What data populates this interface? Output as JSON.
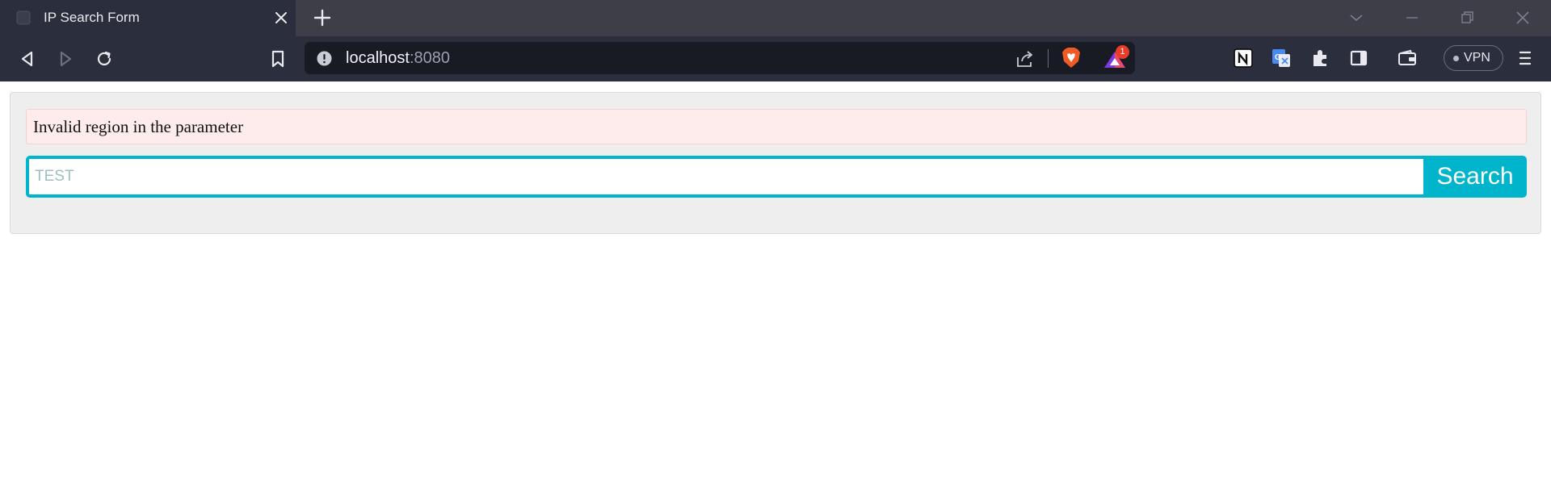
{
  "browser": {
    "tab": {
      "title": "IP Search Form"
    },
    "address_bar": {
      "host": "localhost",
      "port": ":8080"
    },
    "rewards_badge_count": "1",
    "vpn_label": "VPN"
  },
  "form": {
    "error_message": "Invalid region in the parameter",
    "search_input": {
      "value": "",
      "placeholder": "TEST"
    },
    "search_button_label": "Search"
  },
  "colors": {
    "accent": "#00b4cc",
    "error_background": "#fdeceb",
    "panel_background": "#eeeeee"
  },
  "icons": [
    "back-icon",
    "forward-icon",
    "reload-icon",
    "bookmark-icon",
    "info-icon",
    "share-icon",
    "brave-shields-icon",
    "brave-rewards-icon",
    "notion-icon",
    "google-translate-icon",
    "extensions-icon",
    "sidebar-icon",
    "wallet-icon",
    "menu-icon",
    "close-icon",
    "plus-icon",
    "minimize-icon",
    "maximize-icon",
    "chevron-down-icon"
  ]
}
